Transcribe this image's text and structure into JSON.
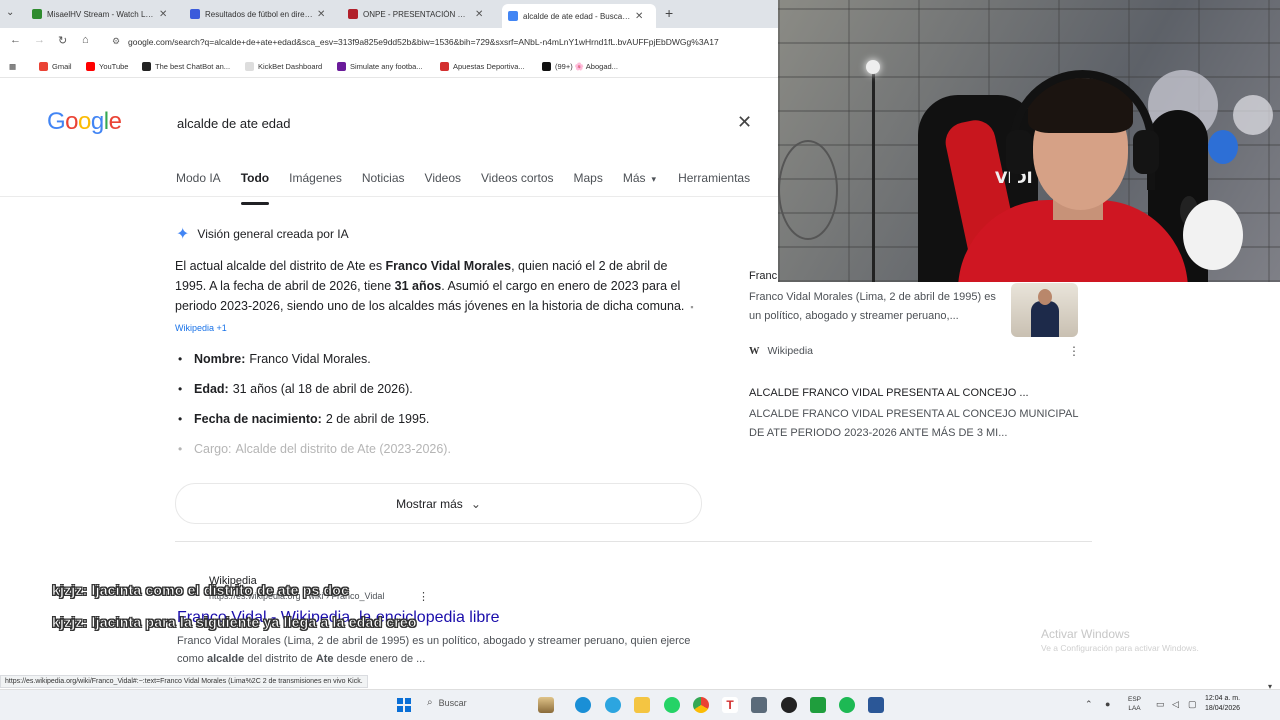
{
  "browser": {
    "tabs": [
      {
        "title": "MisaelHV Stream - Watch Live o...",
        "color": "#2e8b2e"
      },
      {
        "title": "Resultados de fútbol en directo...",
        "color": "#3b5bdb"
      },
      {
        "title": "ONPE - PRESENTACIÓN DE RES...",
        "color": "#b11f2a"
      },
      {
        "title": "alcalde de ate edad - Buscar c...",
        "color": "#4285f4"
      }
    ],
    "url": "google.com/search?q=alcalde+de+ate+edad&sca_esv=313f9a825e9dd52b&biw=1536&bih=729&sxsrf=ANbL-n4mLnY1wHrnd1fL.bvAUFFpjEbDWGg%3A17",
    "bookmarks": [
      {
        "label": "Gmail",
        "color": "#ea4335"
      },
      {
        "label": "YouTube",
        "color": "#ff0000"
      },
      {
        "label": "The best ChatBot an...",
        "color": "#222222"
      },
      {
        "label": "KickBet Dashboard",
        "color": "#dddddd"
      },
      {
        "label": "Simulate any footba...",
        "color": "#6a1b9a"
      },
      {
        "label": "Apuestas Deportiva...",
        "color": "#d32f2f"
      },
      {
        "label": "(99+) 🌸 Abogad...",
        "color": "#111111"
      }
    ]
  },
  "google": {
    "logo": [
      "G",
      "o",
      "o",
      "g",
      "l",
      "e"
    ],
    "logo_colors": [
      "#4285f4",
      "#ea4335",
      "#fbbc05",
      "#4285f4",
      "#34a853",
      "#ea4335"
    ],
    "query": "alcalde de ate edad",
    "tabs": [
      "Modo IA",
      "Todo",
      "Imágenes",
      "Noticias",
      "Videos",
      "Videos cortos",
      "Maps",
      "Más",
      "Herramientas"
    ],
    "more_caret": "▾"
  },
  "ai_overview": {
    "heading": "Visión general creada por IA",
    "para": {
      "t1": "El actual alcalde del distrito de Ate es ",
      "b1": "Franco Vidal Morales",
      "t2": ", quien nació el 2 de abril de 1995. A la fecha de abril de 2026, tiene ",
      "b2": "31 años",
      "t3": ". Asumió el cargo en enero de 2023 para el periodo 2023-2026, siendo uno de los alcaldes más jóvenes en la historia de dicha comuna.",
      "cite": "Wikipedia +1"
    },
    "list": [
      {
        "k": "Nombre:",
        "v": "Franco Vidal Morales."
      },
      {
        "k": "Edad:",
        "v": "31 años (al 18 de abril de 2026)."
      },
      {
        "k": "Fecha de nacimiento:",
        "v": "2 de abril de 1995."
      },
      {
        "k": "Cargo:",
        "v": "Alcalde del distrito de Ate (2023-2026)."
      }
    ],
    "show_more": "Mostrar más"
  },
  "sources": {
    "s1_title": "Franc",
    "s1_text": "Franco Vidal Morales (Lima, 2 de abril de 1995) es un político, abogado y streamer peruano,...",
    "s1_site": "Wikipedia",
    "s2_title": "ALCALDE FRANCO VIDAL PRESENTA AL CONCEJO ...",
    "s2_text": "ALCALDE FRANCO VIDAL PRESENTA AL CONCEJO MUNICIPAL DE ATE PERIODO 2023-2026 ANTE MÁS DE 3 MI..."
  },
  "result": {
    "site": "Wikipedia",
    "url": "https://es.wikipedia.org › wiki › Franco_Vidal",
    "title": "Franco Vidal - Wikipedia, la enciclopedia libre",
    "snippet_1": "Franco Vidal Morales (Lima, 2 de abril de 1995) es un político, abogado y streamer peruano, quien ejerce como ",
    "snippet_b1": "alcalde",
    "snippet_2": " del distrito de ",
    "snippet_b2": "Ate",
    "snippet_3": " desde enero de ..."
  },
  "chat": [
    "kjzjz: ljacinta como el distrito de ate ps doc",
    "kjzjz: ljacinta para la siguiente ya llega a la edad creo"
  ],
  "status_link": "https://es.wikipedia.org/wiki/Franco_Vidal#:~:text=Franco Vidal Morales (Lima%2C 2 de transmisiones en vivo Kick.",
  "activate": {
    "title": "Activar Windows",
    "sub": "Ve a Configuración para activar Windows."
  },
  "taskbar": {
    "search": "Buscar",
    "lang": "ESP\nLAA",
    "time": "12:04 a. m.",
    "date": "18/04/2026"
  },
  "webcam": {
    "label": "VIDI"
  }
}
